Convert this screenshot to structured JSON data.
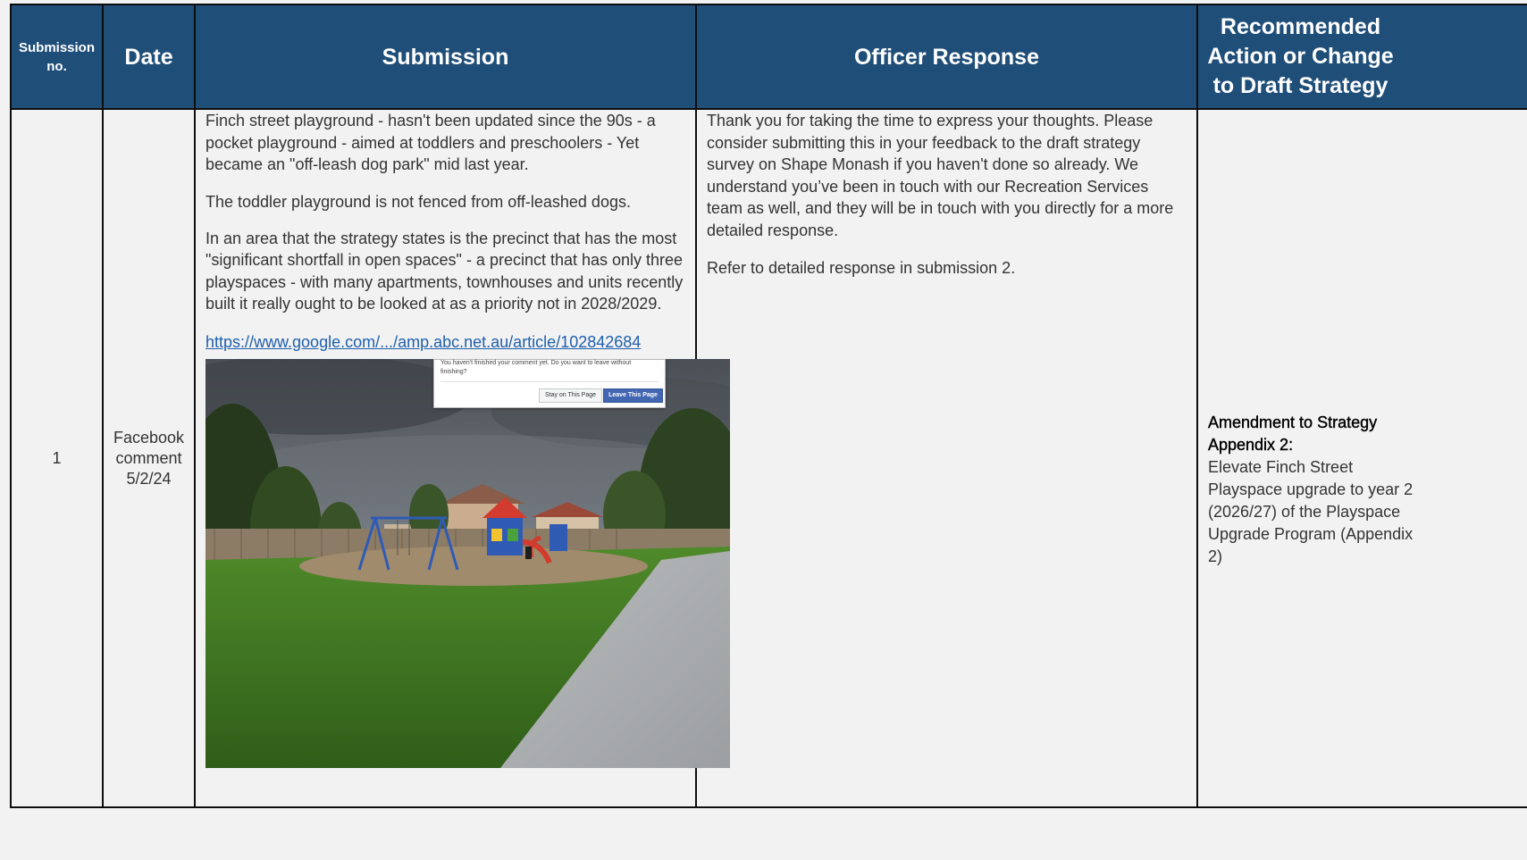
{
  "table": {
    "headers": {
      "submission_no": "Submission no.",
      "date": "Date",
      "submission": "Submission",
      "officer_response": "Officer Response",
      "recommended_action": "Recommended Action or Change to Draft Strategy"
    },
    "rows": [
      {
        "submission_no": "1",
        "date": "Facebook comment 5/2/24",
        "submission": {
          "paragraphs": [
            "Finch street playground - hasn't been updated since the 90s - a pocket playground - aimed at toddlers and preschoolers - Yet became an \"off-leash dog park\" mid last year.",
            "The toddler playground is not fenced from off-leashed dogs.",
            "In an area that the strategy states is the precinct that has the most \"significant shortfall in open spaces\" - a precinct that has only three playspaces - with many apartments, townhouses and units recently built it really ought to be looked at as a priority not in 2028/2029."
          ],
          "link": "https://www.google.com/.../amp.abc.net.au/article/102842684",
          "photo_dialog": {
            "message": "You haven't finished your comment yet. Do you want to leave without finishing?",
            "stay_button": "Stay on This Page",
            "leave_button": "Leave This Page"
          }
        },
        "officer_response": [
          "Thank you for taking the time to express your thoughts. Please consider submitting this in your feedback to the draft strategy survey on Shape Monash if you haven't done so already. We understand you’ve been in touch with our Recreation Services team as well, and they will be in touch with you directly for a more detailed response.",
          "Refer to detailed response in submission 2."
        ],
        "recommended_action": {
          "heading": "Amendment to Strategy Appendix 2:",
          "body": "Elevate Finch Street Playspace upgrade to year 2 (2026/27) of the Playspace Upgrade Program (Appendix 2)"
        }
      }
    ]
  },
  "colors": {
    "header_bg": "#1f4e79",
    "header_text": "#ffffff",
    "cell_bg": "#f2f2f2",
    "link": "#1f5fad",
    "border": "#0d0d0d"
  }
}
